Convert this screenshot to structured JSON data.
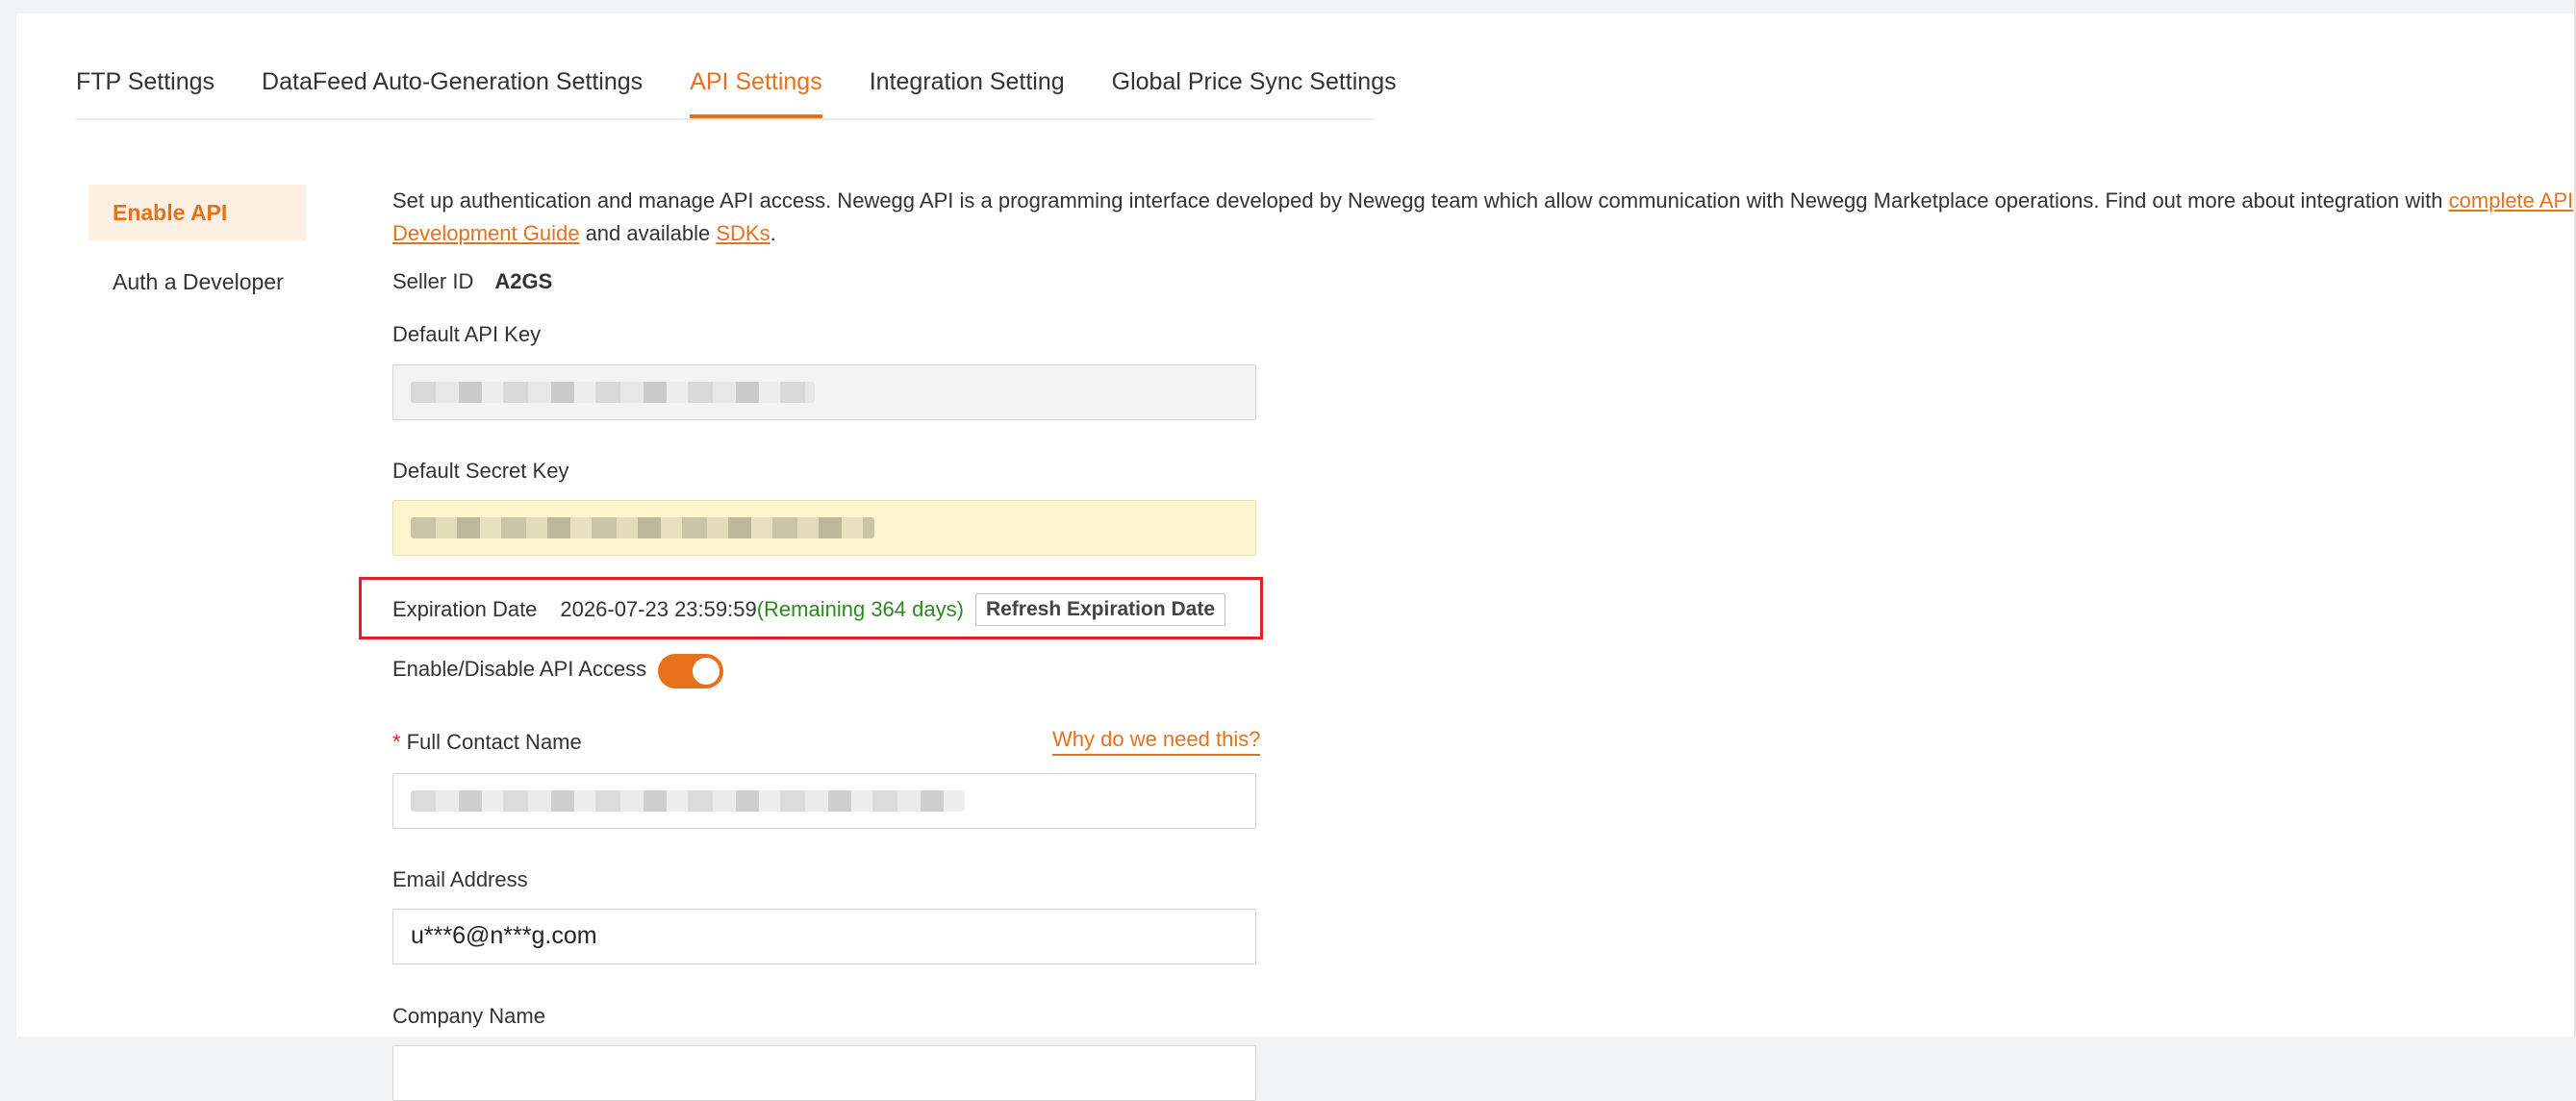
{
  "tabs": [
    {
      "label": "FTP Settings",
      "active": false
    },
    {
      "label": "DataFeed Auto-Generation Settings",
      "active": false
    },
    {
      "label": "API Settings",
      "active": true
    },
    {
      "label": "Integration Setting",
      "active": false
    },
    {
      "label": "Global Price Sync Settings",
      "active": false
    }
  ],
  "sidebar": {
    "items": [
      {
        "label": "Enable API",
        "active": true
      },
      {
        "label": "Auth a Developer",
        "active": false
      }
    ]
  },
  "intro": {
    "text": "Set up authentication and manage API access. Newegg API is a programming interface developed by Newegg team which allow communication with Newegg Marketplace operations. Find out more about integration with ",
    "guide_link": "complete API Development Guide",
    "middle": " and available ",
    "sdk_link": "SDKs",
    "end": "."
  },
  "seller": {
    "label": "Seller ID",
    "value": "A2GS"
  },
  "api_key": {
    "label": "Default API Key"
  },
  "secret_key": {
    "label": "Default Secret Key"
  },
  "expiration": {
    "label": "Expiration Date",
    "date": "2026-07-23 23:59:59",
    "remaining": "(Remaining 364 days)",
    "refresh_label": "Refresh Expiration Date"
  },
  "api_access": {
    "label": "Enable/Disable API Access",
    "enabled": true
  },
  "contact": {
    "label": "Full Contact Name",
    "why_link": "Why do we need this?"
  },
  "email": {
    "label": "Email Address",
    "value": "u***6@n***g.com"
  },
  "company": {
    "label": "Company Name"
  },
  "colors": {
    "accent": "#e8701a",
    "success": "#2b8a1e",
    "highlight_border": "#e01f26"
  }
}
